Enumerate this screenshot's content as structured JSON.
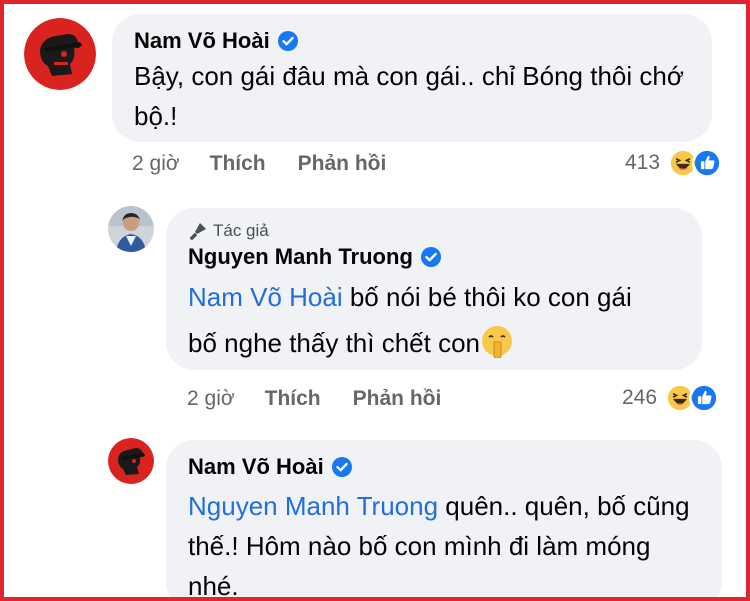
{
  "comments": [
    {
      "author": "Nam Võ Hoài",
      "verified": true,
      "text": "Bậy, con gái đâu mà con gái.. chỉ Bóng thôi chớ bộ.!",
      "time": "2 giờ",
      "like_label": "Thích",
      "reply_label": "Phản hồi",
      "reaction_count": "413",
      "reaction_icons": [
        "haha-icon",
        "like-icon"
      ]
    },
    {
      "author_badge": "Tác giả",
      "author": "Nguyen Manh Truong",
      "verified": true,
      "mention": "Nam Võ Hoài",
      "text": " bố nói bé thôi ko con gái bố nghe thấy thì chết con",
      "text_emoji": "shushing-face-icon",
      "time": "2 giờ",
      "like_label": "Thích",
      "reply_label": "Phản hồi",
      "reaction_count": "246",
      "reaction_icons": [
        "haha-icon",
        "like-icon"
      ]
    },
    {
      "author": "Nam Võ Hoài",
      "verified": true,
      "mention": "Nguyen Manh Truong",
      "text": " quên.. quên, bố cũng thế.! Hôm nào bố con mình đi làm móng nhé."
    }
  ],
  "colors": {
    "frame_border": "#e0262c",
    "bubble_bg": "#f0f2f5",
    "mention": "#216fdb",
    "verified": "#1877f2",
    "meta_text": "#65676b"
  }
}
